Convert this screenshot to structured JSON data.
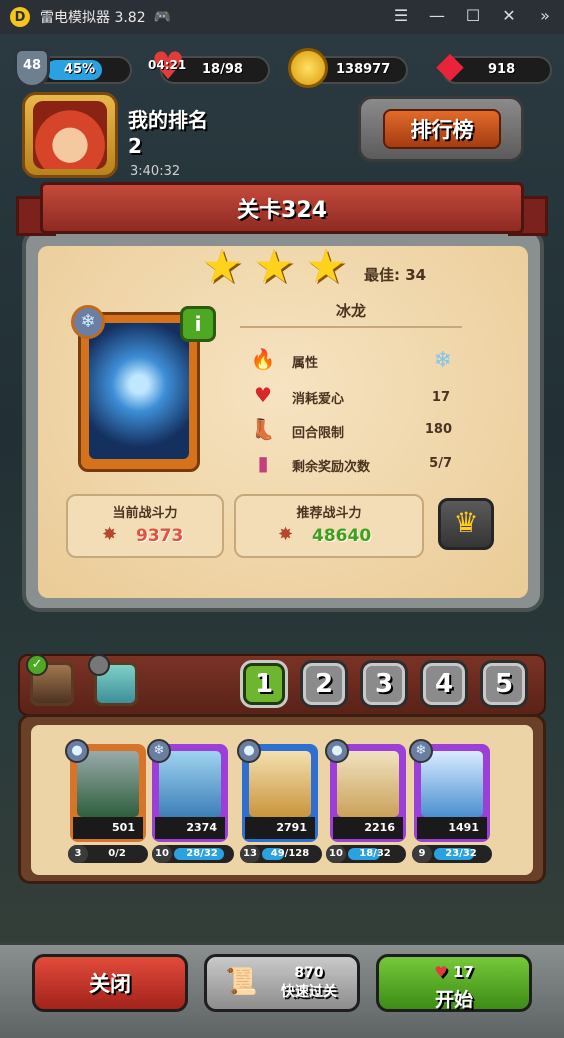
{
  "emulator": {
    "title": "雷电模拟器 3.82",
    "controls": [
      "menu-icon",
      "minimize-icon",
      "maximize-icon",
      "close-icon",
      "sidebar-toggle-icon"
    ]
  },
  "status": {
    "level": "48",
    "level_progress": "45%",
    "lives_timer": "04:21",
    "lives": "18/98",
    "gold": "138977",
    "gems": "918"
  },
  "ranking": {
    "title": "我的排名",
    "value": "2",
    "timer": "3:40:32",
    "leaderboard_label": "排行榜"
  },
  "level": {
    "title": "关卡324",
    "stars": 3,
    "best": "最佳: 34",
    "monster_name": "冰龙",
    "rows": [
      {
        "icon": "element-icon",
        "label": "属性",
        "value": "❄"
      },
      {
        "icon": "heart-icon",
        "label": "消耗爱心",
        "value": "17"
      },
      {
        "icon": "boot-icon",
        "label": "回合限制",
        "value": "180"
      },
      {
        "icon": "reward-card-icon",
        "label": "剩余奖励次数",
        "value": "5/7"
      }
    ],
    "current_power_label": "当前战斗力",
    "current_power": "9373",
    "recommended_power_label": "推荐战斗力",
    "recommended_power": "48640"
  },
  "teams": {
    "tabs": [
      "1",
      "2",
      "3",
      "4",
      "5"
    ],
    "active": "1"
  },
  "heroes": [
    {
      "power": "501",
      "level": "3",
      "progress": "0/2",
      "frame": "#d8742a",
      "art": "#2f5f3d"
    },
    {
      "power": "2374",
      "level": "10",
      "progress": "28/32",
      "frame": "#9b3fd8",
      "art": "#3d7fb8"
    },
    {
      "power": "2791",
      "level": "13",
      "progress": "49/128",
      "frame": "#2f6fd0",
      "art": "#c9953c"
    },
    {
      "power": "2216",
      "level": "10",
      "progress": "18/32",
      "frame": "#9b3fd8",
      "art": "#caa25a"
    },
    {
      "power": "1491",
      "level": "9",
      "progress": "23/32",
      "frame": "#9b3fd8",
      "art": "#4a8fd0"
    }
  ],
  "bottom": {
    "close_label": "关闭",
    "skip_count": "870",
    "skip_label": "快速过关",
    "start_hearts": "17",
    "start_label": "开始"
  },
  "colors": {
    "current_power": "#e0533f",
    "recommended_power": "#3fa11a",
    "xp_bar": "#2aa1e0"
  }
}
